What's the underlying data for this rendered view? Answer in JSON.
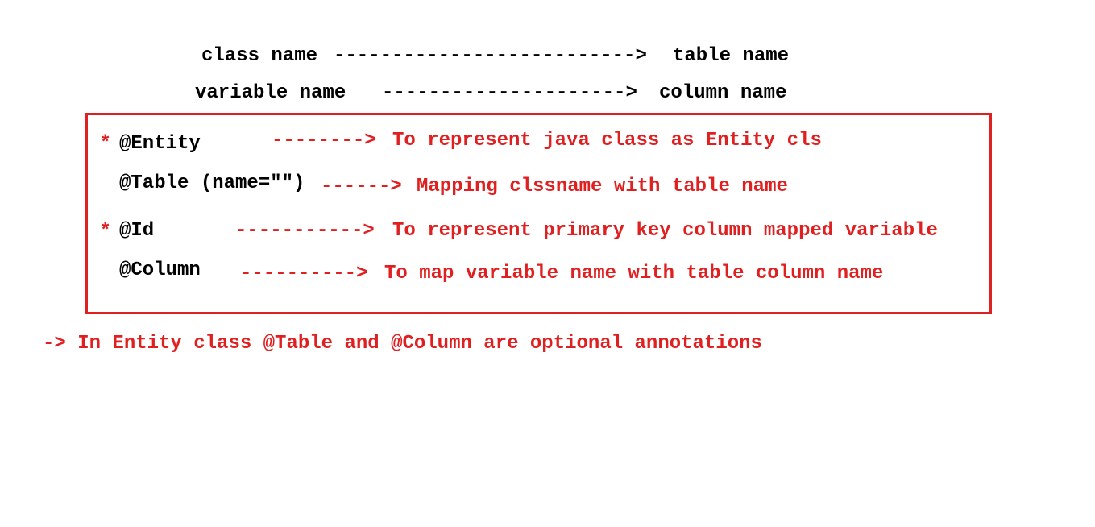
{
  "colors": {
    "accent": "#e02020",
    "text": "#000000",
    "background": "#ffffff"
  },
  "mapping_rules": [
    {
      "left": "class name",
      "arrow": "-------------------------->",
      "right": "table name"
    },
    {
      "left": "variable name",
      "arrow": "--------------------->",
      "right": "column name"
    }
  ],
  "annotations": [
    {
      "star": "*",
      "name": "@Entity",
      "arrow": "-------->",
      "description": "To represent java class as Entity cls"
    },
    {
      "star": "",
      "name": "@Table (name=\"\")",
      "arrow": "------>",
      "description": "Mapping clssname with table name"
    },
    {
      "star": "*",
      "name": "@Id",
      "arrow": "----------->",
      "description": "To represent primary key column mapped variable"
    },
    {
      "star": "",
      "name": "@Column",
      "arrow": "---------->",
      "description": "To map variable name with table column name"
    }
  ],
  "note": "-> In Entity class @Table and @Column are optional annotations"
}
